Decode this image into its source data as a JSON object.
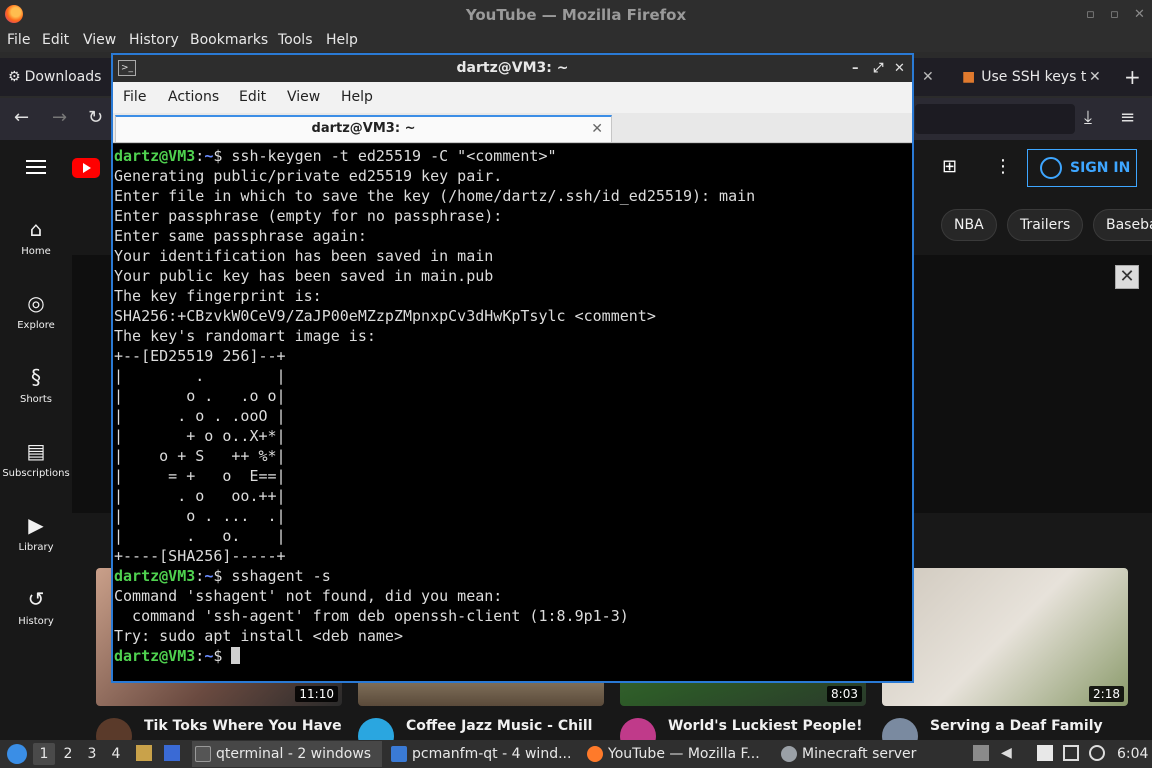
{
  "firefox": {
    "window_title": "YouTube — Mozilla Firefox",
    "menu": [
      "File",
      "Edit",
      "View",
      "History",
      "Bookmarks",
      "Tools",
      "Help"
    ],
    "tabs": {
      "left_label": "Downloads",
      "right_label": "Use SSH keys t"
    }
  },
  "youtube": {
    "sidebar": [
      {
        "label": "Home",
        "icon": "home-icon"
      },
      {
        "label": "Explore",
        "icon": "compass-icon"
      },
      {
        "label": "Shorts",
        "icon": "shorts-icon"
      },
      {
        "label": "Subscriptions",
        "icon": "subscriptions-icon"
      },
      {
        "label": "Library",
        "icon": "library-icon"
      },
      {
        "label": "History",
        "icon": "history-icon"
      }
    ],
    "sign_in": "SIGN IN",
    "chips": [
      "NBA",
      "Trailers",
      "Baseba"
    ],
    "videos": [
      {
        "title": "Tik Toks Where You Have",
        "duration": "11:10"
      },
      {
        "title": "Coffee Jazz Music - Chill",
        "duration": ""
      },
      {
        "title": "World's Luckiest People!",
        "duration": "8:03"
      },
      {
        "title": "Serving a Deaf Family",
        "duration": "2:18"
      }
    ]
  },
  "terminal": {
    "window_title": "dartz@VM3: ~",
    "menu": [
      "File",
      "Actions",
      "Edit",
      "View",
      "Help"
    ],
    "tab_label": "dartz@VM3: ~",
    "prompt_user": "dartz@VM3",
    "prompt_path": "~",
    "lines": [
      {
        "type": "prompt",
        "cmd": "ssh-keygen -t ed25519 -C \"<comment>\""
      },
      {
        "type": "out",
        "text": "Generating public/private ed25519 key pair."
      },
      {
        "type": "out",
        "text": "Enter file in which to save the key (/home/dartz/.ssh/id_ed25519): main"
      },
      {
        "type": "out",
        "text": "Enter passphrase (empty for no passphrase):"
      },
      {
        "type": "out",
        "text": "Enter same passphrase again:"
      },
      {
        "type": "out",
        "text": "Your identification has been saved in main"
      },
      {
        "type": "out",
        "text": "Your public key has been saved in main.pub"
      },
      {
        "type": "out",
        "text": "The key fingerprint is:"
      },
      {
        "type": "out",
        "text": "SHA256:+CBzvkW0CeV9/ZaJP00eMZzpZMpnxpCv3dHwKpTsylc <comment>"
      },
      {
        "type": "out",
        "text": "The key's randomart image is:"
      },
      {
        "type": "out",
        "text": "+--[ED25519 256]--+"
      },
      {
        "type": "out",
        "text": "|        .        |"
      },
      {
        "type": "out",
        "text": "|       o .   .o o|"
      },
      {
        "type": "out",
        "text": "|      . o . .ooO |"
      },
      {
        "type": "out",
        "text": "|       + o o..X+*|"
      },
      {
        "type": "out",
        "text": "|    o + S   ++ %*|"
      },
      {
        "type": "out",
        "text": "|     = +   o  E==|"
      },
      {
        "type": "out",
        "text": "|      . o   oo.++|"
      },
      {
        "type": "out",
        "text": "|       o . ...  .|"
      },
      {
        "type": "out",
        "text": "|       .   o.    |"
      },
      {
        "type": "out",
        "text": "+----[SHA256]-----+"
      },
      {
        "type": "prompt",
        "cmd": "sshagent -s"
      },
      {
        "type": "out",
        "text": "Command 'sshagent' not found, did you mean:"
      },
      {
        "type": "out",
        "text": "  command 'ssh-agent' from deb openssh-client (1:8.9p1-3)"
      },
      {
        "type": "out",
        "text": "Try: sudo apt install <deb name>"
      },
      {
        "type": "prompt",
        "cmd": "",
        "cursor": true
      }
    ]
  },
  "taskbar": {
    "workspaces": [
      "1",
      "2",
      "3",
      "4"
    ],
    "active_workspace": "1",
    "tasks": [
      {
        "label": "qterminal - 2 windows",
        "icon": "terminal-icon",
        "active": true
      },
      {
        "label": "pcmanfm-qt - 4 wind...",
        "icon": "folder-icon",
        "active": false
      },
      {
        "label": "YouTube — Mozilla F...",
        "icon": "firefox-icon",
        "active": false
      },
      {
        "label": "Minecraft server",
        "icon": "telegram-icon",
        "active": false
      }
    ],
    "clock": "6:04"
  }
}
